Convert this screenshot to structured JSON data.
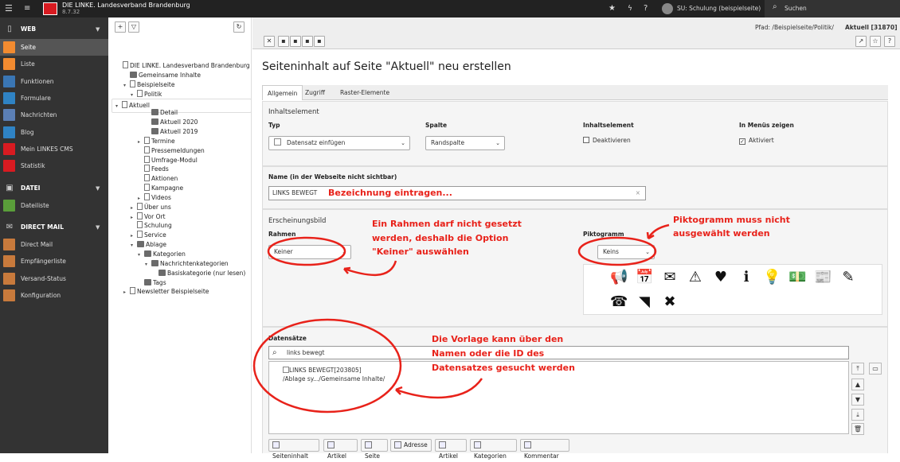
{
  "topbar": {
    "org_name": "DIE LINKE. Landesverband Brandenburg",
    "version": "8.7.32",
    "user": "SU: Schulung (beispielseite)",
    "search_label": "Suchen"
  },
  "nav": {
    "sections": [
      {
        "label": "WEB"
      },
      {
        "label": "DATEI"
      },
      {
        "label": "DIRECT MAIL"
      }
    ],
    "web_items": [
      {
        "label": "Seite",
        "color": "#f28b30"
      },
      {
        "label": "Liste",
        "color": "#f28b30"
      },
      {
        "label": "Funktionen",
        "color": "#3a76b4"
      },
      {
        "label": "Formulare",
        "color": "#2f83c4"
      },
      {
        "label": "Nachrichten",
        "color": "#5b7fb5"
      },
      {
        "label": "Blog",
        "color": "#2f83c4"
      },
      {
        "label": "Mein LINKES CMS",
        "color": "#d81b21"
      },
      {
        "label": "Statistik",
        "color": "#d81b21"
      }
    ],
    "datei_items": [
      {
        "label": "Dateiliste",
        "color": "#5a9e3a"
      }
    ],
    "mail_items": [
      {
        "label": "Direct Mail",
        "color": "#c87a3c"
      },
      {
        "label": "Empfängerliste",
        "color": "#c87a3c"
      },
      {
        "label": "Versand-Status",
        "color": "#c87a3c"
      },
      {
        "label": "Konfiguration",
        "color": "#c87a3c"
      }
    ]
  },
  "tree": {
    "root": "DIE LINKE. Landesverband Brandenburg",
    "nodes": [
      "Gemeinsame Inhalte",
      "Beispielseite",
      "Politik",
      "Aktuell",
      "Detail",
      "Aktuell 2020",
      "Aktuell 2019",
      "Termine",
      "Pressemeldungen",
      "Umfrage-Modul",
      "Feeds",
      "Aktionen",
      "Kampagne",
      "Videos",
      "Über uns",
      "Vor Ort",
      "Schulung",
      "Service",
      "Ablage",
      "Kategorien",
      "Nachrichtenkategorien",
      "Basiskategorie (nur lesen)",
      "Tags",
      "Newsletter Beispielseite"
    ]
  },
  "header": {
    "path_label": "Pfad: /Beispielseite/Politik/",
    "path_current": "Aktuell [31870]"
  },
  "page": {
    "title": "Seiteninhalt auf Seite \"Aktuell\" neu erstellen",
    "tabs": [
      "Allgemein",
      "Zugriff",
      "Raster-Elemente"
    ]
  },
  "form": {
    "section_inhaltselement": "Inhaltselement",
    "typ_label": "Typ",
    "typ_value": "Datensatz einfügen",
    "spalte_label": "Spalte",
    "spalte_value": "Randspalte",
    "inhaltselement_label": "Inhaltselement",
    "deaktivieren_label": "Deaktivieren",
    "menus_label": "In Menüs zeigen",
    "aktiviert_label": "Aktiviert",
    "name_label": "Name (in der Webseite nicht sichtbar)",
    "name_value": "LINKS BEWEGT",
    "section_erscheinung": "Erscheinungsbild",
    "rahmen_label": "Rahmen",
    "rahmen_value": "Keiner",
    "pikto_label": "Piktogramm",
    "pikto_value": "Keins",
    "datensaetze_label": "Datensätze",
    "search_value": "links bewegt",
    "result_title": "LINKS BEWEGT[203805]",
    "result_path": "/Ablage sy.../Gemeinsame Inhalte/",
    "buttons": [
      "Seiteninhalt",
      "Artikel",
      "Seite",
      "Adresse",
      "Artikel",
      "Kategorien",
      "Kommentar"
    ]
  },
  "annotations": {
    "name_hint": "Bezeichnung eintragen...",
    "rahmen_hint": [
      "Ein Rahmen darf nicht gesetzt",
      "werden, deshalb die Option",
      "\"Keiner\" auswählen"
    ],
    "pikto_hint": [
      "Piktogramm muss nicht",
      "ausgewählt werden"
    ],
    "datensatz_hint": [
      "Die Vorlage kann über den",
      "Namen oder die ID des",
      "Datensatzes gesucht werden"
    ]
  },
  "pictograms": [
    "megaphone-icon",
    "calendar-check-icon",
    "envelope-icon",
    "warning-icon",
    "heart-icon",
    "info-icon",
    "lightbulb-icon",
    "money-icon",
    "newspaper-icon",
    "edit-icon",
    "phone-icon",
    "rss-icon",
    "x-icon"
  ]
}
